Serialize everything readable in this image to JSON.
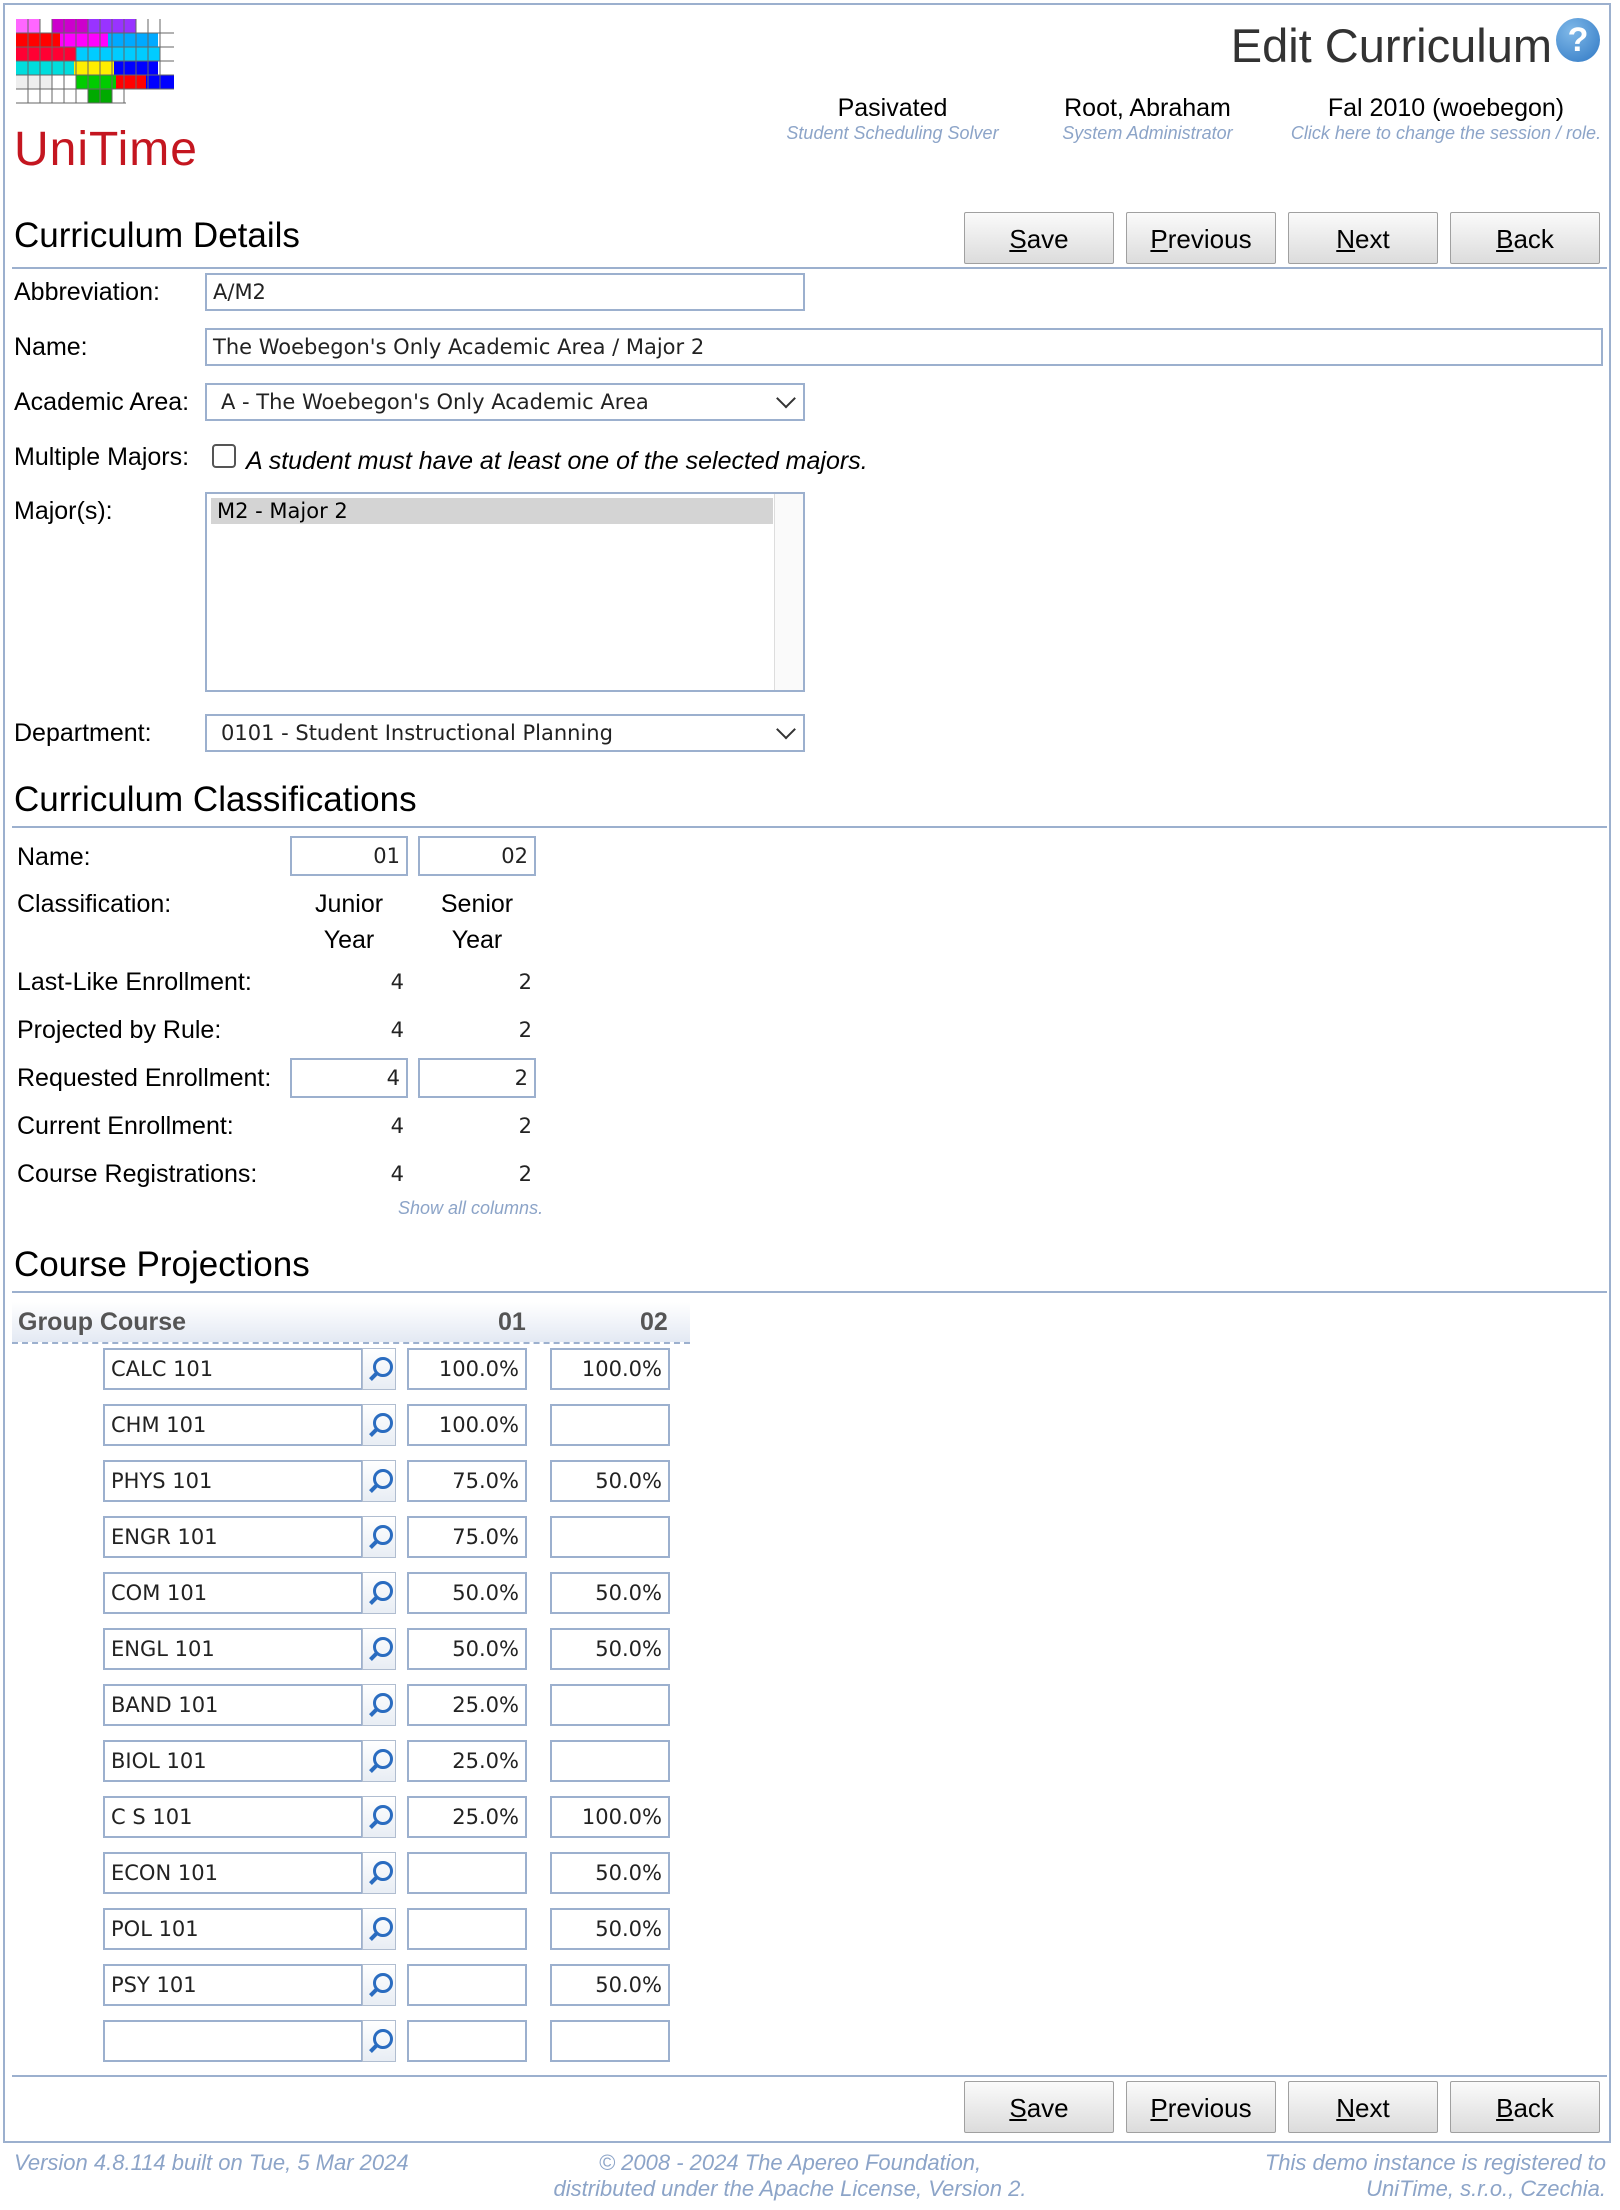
{
  "header": {
    "logo_text": "UniTime",
    "page_title": "Edit Curriculum",
    "help_icon": "question-icon",
    "solver": {
      "main": "Pasivated",
      "sub": "Student Scheduling Solver"
    },
    "user": {
      "main": "Root, Abraham",
      "sub": "System Administrator"
    },
    "session": {
      "main": "Fal 2010 (woebegon)",
      "sub": "Click here to change the session / role."
    }
  },
  "buttons": {
    "save": "ave",
    "save_key": "S",
    "previous": "revious",
    "previous_key": "P",
    "next": "ext",
    "next_key": "N",
    "back": "ack",
    "back_key": "B"
  },
  "details": {
    "title": "Curriculum Details",
    "abbreviation_label": "Abbreviation:",
    "abbreviation_value": "A/M2",
    "name_label": "Name:",
    "name_value": "The Woebegon's Only Academic Area / Major 2",
    "area_label": "Academic Area:",
    "area_value": "A - The Woebegon's Only Academic Area",
    "multiple_majors_label": "Multiple Majors:",
    "multiple_majors_checked": false,
    "multiple_majors_text": "A student must have at least one of the selected majors.",
    "majors_label": "Major(s):",
    "majors_selected": "M2 - Major 2",
    "department_label": "Department:",
    "department_value": "0101 - Student Instructional Planning"
  },
  "classifications": {
    "title": "Curriculum Classifications",
    "labels": {
      "name": "Name:",
      "classification": "Classification:",
      "last_like": "Last-Like Enrollment:",
      "projected": "Projected by Rule:",
      "requested": "Requested Enrollment:",
      "current": "Current Enrollment:",
      "registrations": "Course Registrations:"
    },
    "columns": [
      {
        "name": "01",
        "classification_line1": "Junior",
        "classification_line2": "Year",
        "last_like": "4",
        "projected": "4",
        "requested": "4",
        "current": "4",
        "registrations": "4"
      },
      {
        "name": "02",
        "classification_line1": "Senior",
        "classification_line2": "Year",
        "last_like": "2",
        "projected": "2",
        "requested": "2",
        "current": "2",
        "registrations": "2"
      }
    ],
    "show_all": "Show all columns."
  },
  "projections": {
    "title": "Course Projections",
    "header": {
      "group_course": "Group Course",
      "c1": "01",
      "c2": "02"
    },
    "rows": [
      {
        "course": "CALC 101",
        "c1": "100.0%",
        "c2": "100.0%"
      },
      {
        "course": "CHM 101",
        "c1": "100.0%",
        "c2": ""
      },
      {
        "course": "PHYS 101",
        "c1": "75.0%",
        "c2": "50.0%"
      },
      {
        "course": "ENGR 101",
        "c1": "75.0%",
        "c2": ""
      },
      {
        "course": "COM 101",
        "c1": "50.0%",
        "c2": "50.0%"
      },
      {
        "course": "ENGL 101",
        "c1": "50.0%",
        "c2": "50.0%"
      },
      {
        "course": "BAND 101",
        "c1": "25.0%",
        "c2": ""
      },
      {
        "course": "BIOL 101",
        "c1": "25.0%",
        "c2": ""
      },
      {
        "course": "C S 101",
        "c1": "25.0%",
        "c2": "100.0%"
      },
      {
        "course": "ECON 101",
        "c1": "",
        "c2": "50.0%"
      },
      {
        "course": "POL 101",
        "c1": "",
        "c2": "50.0%"
      },
      {
        "course": "PSY 101",
        "c1": "",
        "c2": "50.0%"
      },
      {
        "course": "",
        "c1": "",
        "c2": ""
      }
    ]
  },
  "footer": {
    "version": "Version 4.8.114 built on Tue, 5 Mar 2024",
    "copyright_line1": "© 2008 - 2024 The Apereo Foundation,",
    "copyright_line2": "distributed under the Apache License, Version 2.",
    "registered_line1": "This demo instance is registered to",
    "registered_line2": "UniTime, s.r.o., Czechia."
  }
}
